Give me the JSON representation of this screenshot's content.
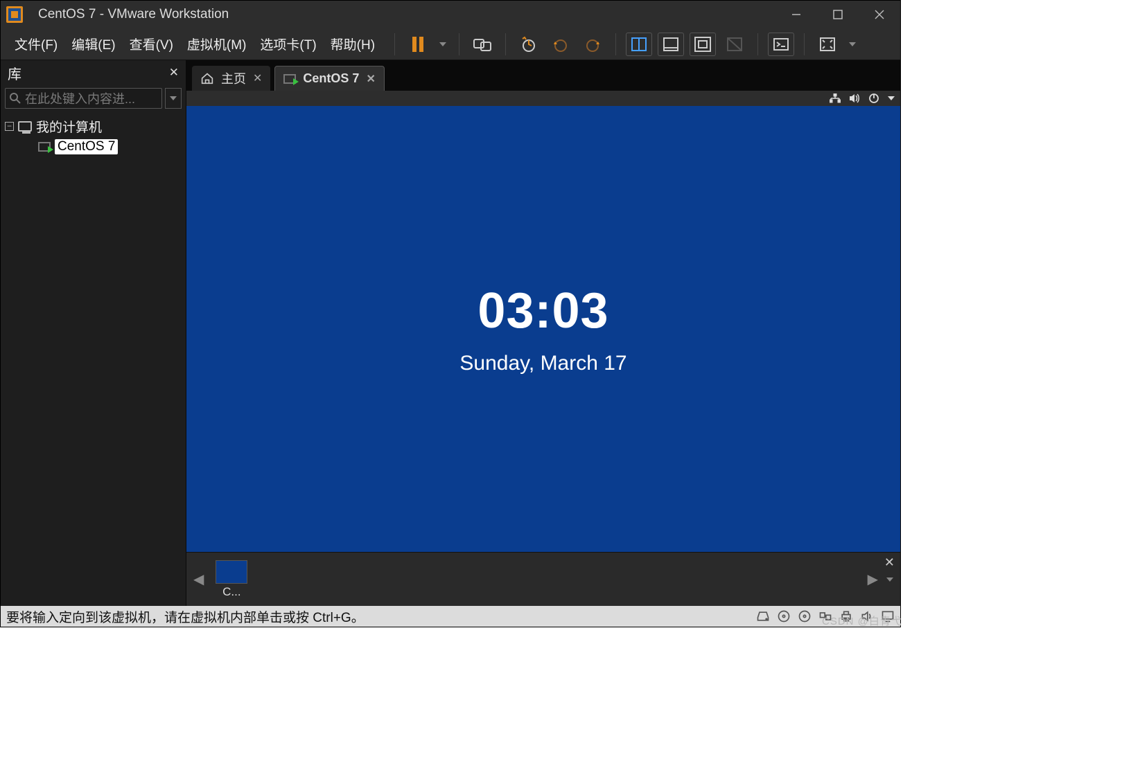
{
  "title": "CentOS 7 - VMware Workstation",
  "menu": {
    "file": "文件(F)",
    "edit": "编辑(E)",
    "view": "查看(V)",
    "vm": "虚拟机(M)",
    "tabs": "选项卡(T)",
    "help": "帮助(H)"
  },
  "library": {
    "title": "库",
    "search_placeholder": "在此处键入内容进...",
    "root": "我的计算机",
    "items": [
      "CentOS 7"
    ]
  },
  "tabs": {
    "home": "主页",
    "vm": "CentOS 7"
  },
  "guest": {
    "time": "03:03",
    "date": "Sunday, March 17"
  },
  "thumb": {
    "label": "C..."
  },
  "status": {
    "hint": "要将输入定向到该虚拟机，请在虚拟机内部单击或按 Ctrl+G。"
  },
  "watermark": "CSDN @白青弋"
}
